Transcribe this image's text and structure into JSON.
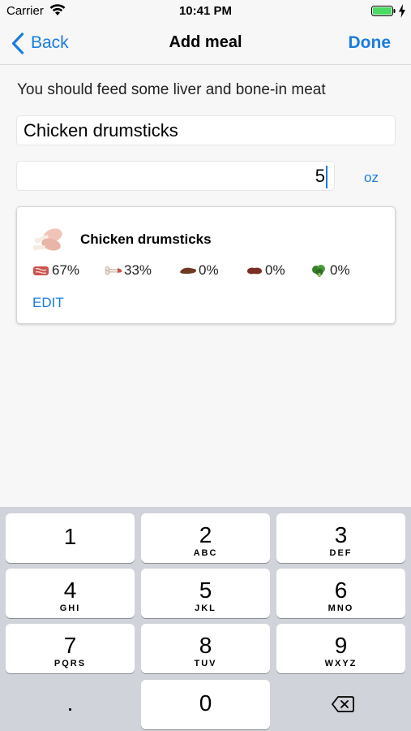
{
  "status": {
    "carrier": "Carrier",
    "time": "10:41 PM"
  },
  "nav": {
    "back_label": "Back",
    "title": "Add meal",
    "done_label": "Done"
  },
  "hint": "You should feed some liver and bone-in meat",
  "form": {
    "name_value": "Chicken drumsticks",
    "amount_value": "5",
    "unit_label": "oz"
  },
  "card": {
    "title": "Chicken drumsticks",
    "stats": [
      {
        "icon": "meat-icon",
        "value": "67%"
      },
      {
        "icon": "bone-icon",
        "value": "33%"
      },
      {
        "icon": "liver-icon",
        "value": "0%"
      },
      {
        "icon": "organ-icon",
        "value": "0%"
      },
      {
        "icon": "vegetable-icon",
        "value": "0%"
      }
    ],
    "edit_label": "EDIT"
  },
  "keyboard": {
    "keys": [
      {
        "num": "1",
        "letters": ""
      },
      {
        "num": "2",
        "letters": "ABC"
      },
      {
        "num": "3",
        "letters": "DEF"
      },
      {
        "num": "4",
        "letters": "GHI"
      },
      {
        "num": "5",
        "letters": "JKL"
      },
      {
        "num": "6",
        "letters": "MNO"
      },
      {
        "num": "7",
        "letters": "PQRS"
      },
      {
        "num": "8",
        "letters": "TUV"
      },
      {
        "num": "9",
        "letters": "WXYZ"
      },
      {
        "num": "0",
        "letters": ""
      }
    ],
    "decimal_label": "."
  },
  "colors": {
    "accent": "#1a7ce0",
    "background": "#f7f7f7",
    "keyboard": "#d0d3d9"
  }
}
